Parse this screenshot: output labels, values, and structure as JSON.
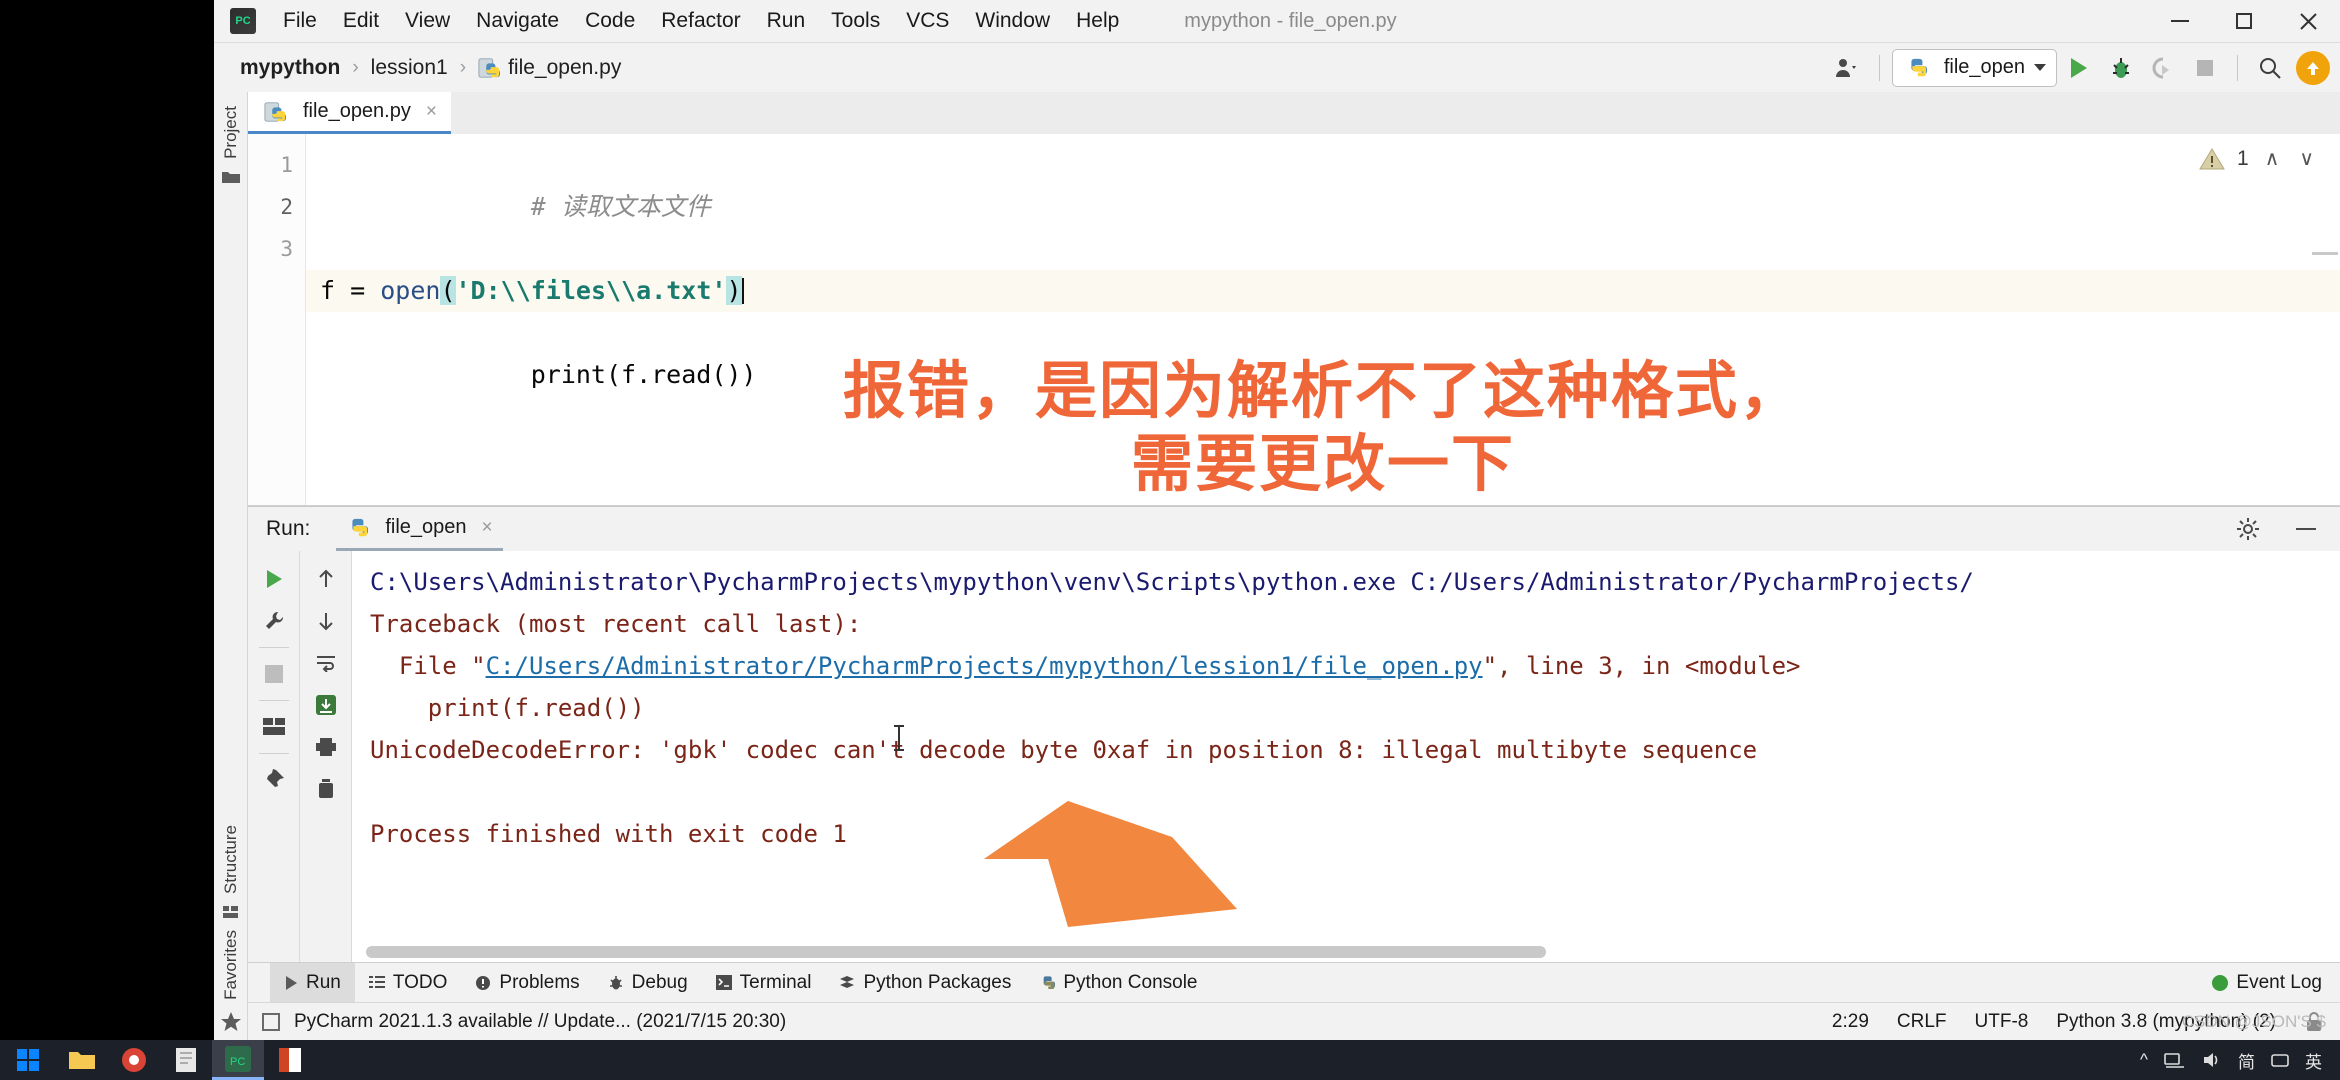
{
  "window": {
    "title": "mypython - file_open.py",
    "logo_text": "PC"
  },
  "menu": {
    "items": [
      "File",
      "Edit",
      "View",
      "Navigate",
      "Code",
      "Refactor",
      "Run",
      "Tools",
      "VCS",
      "Window",
      "Help"
    ]
  },
  "window_controls": {
    "minimize": "minimize-icon",
    "maximize": "maximize-icon",
    "close": "close-icon"
  },
  "navbar": {
    "breadcrumbs": [
      {
        "label": "mypython",
        "bold": true
      },
      {
        "label": "lession1",
        "bold": false
      },
      {
        "label": "file_open.py",
        "bold": false
      }
    ],
    "separator": "›",
    "run_config": "file_open",
    "icons": {
      "user": "user-icon",
      "run": "run-icon",
      "debug": "debug-icon",
      "run_coverage": "run-with-coverage-icon",
      "stop": "stop-icon",
      "search": "search-icon",
      "update": "update-arrow-icon"
    }
  },
  "left_strip": {
    "top": [
      {
        "label": "Project",
        "icon": "folder-icon"
      }
    ],
    "bottom": [
      {
        "label": "Structure",
        "icon": "structure-icon"
      },
      {
        "label": "Favorites",
        "icon": "star-icon"
      }
    ]
  },
  "editor": {
    "tab": {
      "label": "file_open.py",
      "close": "×",
      "icon": "python-file-icon"
    },
    "line_numbers": [
      "1",
      "2",
      "3"
    ],
    "code": {
      "line1_comment": "# 读取文本文件",
      "line2_prefix": "f = ",
      "line2_func": "open",
      "line2_open_paren": "(",
      "line2_string": "'D:\\\\files\\\\a.txt'",
      "line2_close_paren": ")",
      "line3": "print(f.read())"
    },
    "annotation_line1": "报错，是因为解析不了这种格式，",
    "annotation_line2": "需要更改一下",
    "annotation_color": "#ef6638",
    "warning_count": "1",
    "warning_icon": "warning-triangle-icon",
    "chevron_up": "∧",
    "chevron_down": "∨"
  },
  "run_window": {
    "label": "Run:",
    "tab": {
      "label": "file_open",
      "close": "×",
      "icon": "python-file-icon"
    },
    "header_icons": {
      "settings": "gear-icon",
      "hide": "minimize-icon"
    },
    "gutter_icons": [
      "rerun-icon",
      "wrench-icon",
      "stop-icon",
      "layout-icon",
      "pin-icon"
    ],
    "gutter2_icons": [
      "scroll-up-icon",
      "scroll-down-icon",
      "soft-wrap-icon",
      "scroll-to-end-icon",
      "print-icon",
      "trash-icon"
    ],
    "console": [
      {
        "text": "C:\\Users\\Administrator\\PycharmProjects\\mypython\\venv\\Scripts\\python.exe C:/Users/Administrator/PycharmProjects/",
        "type": "cmd"
      },
      {
        "text": "Traceback (most recent call last):",
        "type": "err"
      },
      {
        "pre": "  File \"",
        "link": "C:/Users/Administrator/PycharmProjects/mypython/lession1/file_open.py",
        "post": "\", line 3, in <module>",
        "type": "link"
      },
      {
        "text": "    print(f.read())",
        "type": "err"
      },
      {
        "text": "UnicodeDecodeError: 'gbk' codec can't decode byte 0xaf in position 8: illegal multibyte sequence",
        "type": "err"
      },
      {
        "text": "",
        "type": "blank"
      },
      {
        "text": "Process finished with exit code 1",
        "type": "err"
      }
    ]
  },
  "bottom_tabs": [
    {
      "label": "Run",
      "icon": "run-icon",
      "active": true
    },
    {
      "label": "TODO",
      "icon": "todo-icon",
      "active": false
    },
    {
      "label": "Problems",
      "icon": "problems-icon",
      "active": false
    },
    {
      "label": "Debug",
      "icon": "debug-icon",
      "active": false
    },
    {
      "label": "Terminal",
      "icon": "terminal-icon",
      "active": false
    },
    {
      "label": "Python Packages",
      "icon": "packages-icon",
      "active": false
    },
    {
      "label": "Python Console",
      "icon": "python-console-icon",
      "active": false
    }
  ],
  "event_log": {
    "label": "Event Log",
    "icon": "event-dot-icon"
  },
  "status_bar": {
    "message": "PyCharm 2021.1.3 available // Update... (2021/7/15 20:30)",
    "caret_position": "2:29",
    "line_separator": "CRLF",
    "encoding": "UTF-8",
    "interpreter": "Python 3.8 (mypython) (2)",
    "lock_icon": "unlocked-icon"
  },
  "taskbar": {
    "start": "windows-start-icon",
    "icons": [
      "folder-explorer-icon",
      "chrome-icon",
      "notepad-icon",
      "pycharm-icon",
      "ppt-icon"
    ],
    "tray": [
      "chevron-up-icon",
      "network-icon",
      "volume-icon",
      "ime-simplified-icon",
      "ime-input-icon"
    ],
    "ime_label": "简",
    "ime_label2": "英"
  },
  "watermark": "CSDN @JSON'S $"
}
